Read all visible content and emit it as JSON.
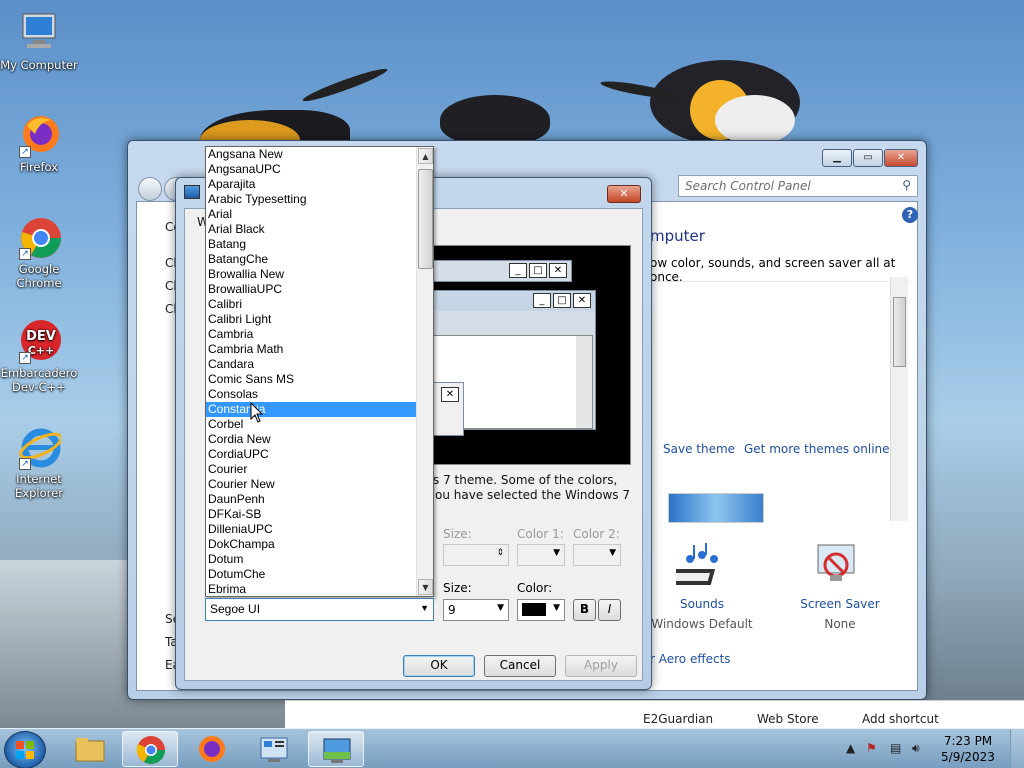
{
  "desktop": {
    "icons": [
      {
        "label": "My Computer"
      },
      {
        "label": "Firefox"
      },
      {
        "label": "Google Chrome"
      },
      {
        "label": "Embarcadero Dev-C++"
      },
      {
        "label": "Internet Explorer"
      }
    ]
  },
  "control_panel": {
    "search_placeholder": "Search Control Panel",
    "heading_fragment": "mputer",
    "subtitle_fragment": "ow color, sounds, and screen saver all at once.",
    "links": {
      "save_theme": "Save theme",
      "more_themes": "Get more themes online",
      "aero": "r Aero effects"
    },
    "bottom_items": [
      {
        "label": "Sounds",
        "value": "Windows Default"
      },
      {
        "label": "Screen Saver",
        "value": "None"
      }
    ],
    "left_fragments": [
      "Co",
      "Ch",
      "Ch",
      "Ch",
      "Se",
      "Ta",
      "Ea"
    ]
  },
  "dialog": {
    "tab_fragment": "W",
    "info_line1": "s 7 theme.  Some of the colors,",
    "info_line2": "ou have selected the Windows 7",
    "size_label_dim": "Size:",
    "color1_label": "Color 1:",
    "color2_label": "Color 2:",
    "size_label": "Size:",
    "color_label": "Color:",
    "font_size_value": "9",
    "bold_label": "B",
    "italic_label": "I",
    "ok_label": "OK",
    "cancel_label": "Cancel",
    "apply_label": "Apply",
    "font_combo_value": "Segoe UI",
    "font_list": [
      "Angsana New",
      "AngsanaUPC",
      "Aparajita",
      "Arabic Typesetting",
      "Arial",
      "Arial Black",
      "Batang",
      "BatangChe",
      "Browallia New",
      "BrowalliaUPC",
      "Calibri",
      "Calibri Light",
      "Cambria",
      "Cambria Math",
      "Candara",
      "Comic Sans MS",
      "Consolas",
      "Constantia",
      "Corbel",
      "Cordia New",
      "CordiaUPC",
      "Courier",
      "Courier New",
      "DaunPenh",
      "DFKai-SB",
      "DilleniaUPC",
      "DokChampa",
      "Dotum",
      "DotumChe",
      "Ebrima"
    ],
    "font_list_selected": "Constantia",
    "accent": "#3399ff"
  },
  "taskbar_links": [
    "E2Guardian",
    "Web Store",
    "Add shortcut"
  ],
  "clock": {
    "time": "7:23 PM",
    "date": "5/9/2023"
  }
}
